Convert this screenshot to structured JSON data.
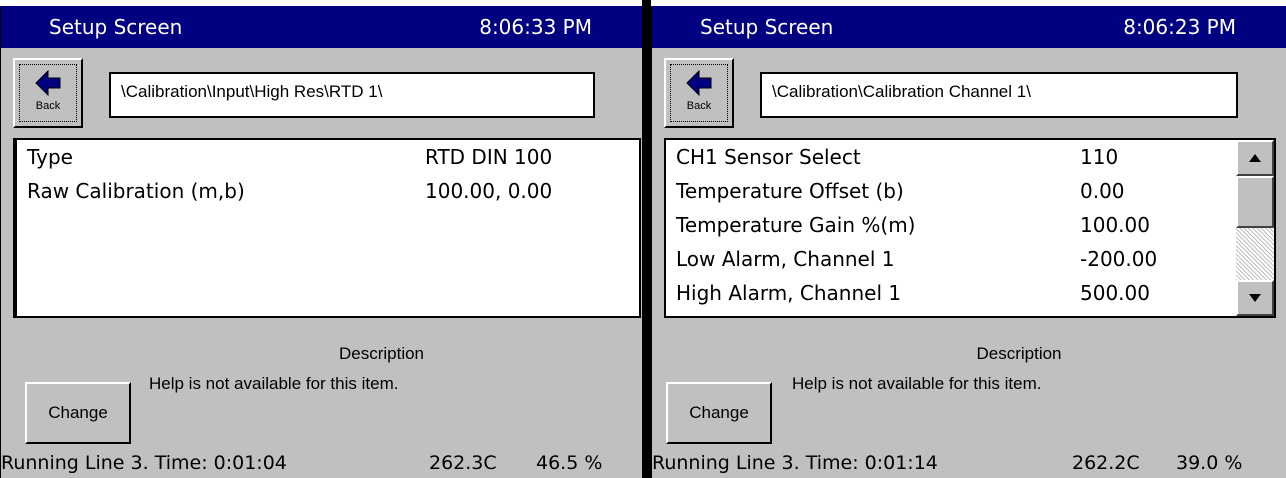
{
  "left": {
    "title": "Setup Screen",
    "clock": "8:06:33 PM",
    "back_label": "Back",
    "path": "\\Calibration\\Input\\High Res\\RTD 1\\",
    "rows": [
      {
        "label": "Type",
        "value": "RTD DIN 100"
      },
      {
        "label": "Raw Calibration (m,b)",
        "value": "100.00, 0.00"
      }
    ],
    "description_title": "Description",
    "description_text": "Help is not available for this item.",
    "change_label": "Change",
    "status": {
      "line": "Running Line 3.  Time: 0:01:04",
      "temp": "262.3C",
      "percent": "46.5 %"
    }
  },
  "right": {
    "title": "Setup Screen",
    "clock": "8:06:23 PM",
    "back_label": "Back",
    "path": "\\Calibration\\Calibration Channel 1\\",
    "rows": [
      {
        "label": "CH1 Sensor Select",
        "value": "110"
      },
      {
        "label": "Temperature Offset (b)",
        "value": "0.00"
      },
      {
        "label": "Temperature Gain %(m)",
        "value": "100.00"
      },
      {
        "label": "Low Alarm, Channel 1",
        "value": "-200.00"
      },
      {
        "label": "High Alarm, Channel 1",
        "value": "500.00"
      }
    ],
    "description_title": "Description",
    "description_text": "Help is not available for this item.",
    "change_label": "Change",
    "status": {
      "line": "Running Line 3.  Time: 0:01:14",
      "temp": "262.2C",
      "percent": "39.0 %"
    }
  },
  "colors": {
    "titlebar": "#000080",
    "panel": "#c0c0c0",
    "back_arrow": "#000080"
  },
  "icons": {
    "back": "left-arrow-icon",
    "scroll_up": "triangle-up-icon",
    "scroll_down": "triangle-down-icon"
  }
}
